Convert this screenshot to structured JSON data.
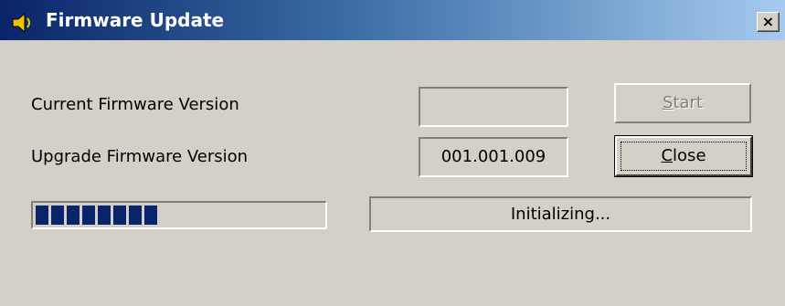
{
  "window": {
    "title": "Firmware Update",
    "title_icon": "speaker-icon",
    "close_glyph": "×"
  },
  "form": {
    "current_label": "Current Firmware Version",
    "current_value": "",
    "upgrade_label": "Upgrade Firmware Version",
    "upgrade_value": "001.001.009"
  },
  "buttons": {
    "start_label": "Start",
    "start_enabled": false,
    "close_label": "Close"
  },
  "progress": {
    "filled_blocks": 8,
    "fraction": 0.45
  },
  "status": {
    "text": "Initializing..."
  },
  "colors": {
    "face": "#d4d0c8",
    "title_start": "#0a246a",
    "title_end": "#a6caf0",
    "progress_fill": "#0a246a"
  }
}
